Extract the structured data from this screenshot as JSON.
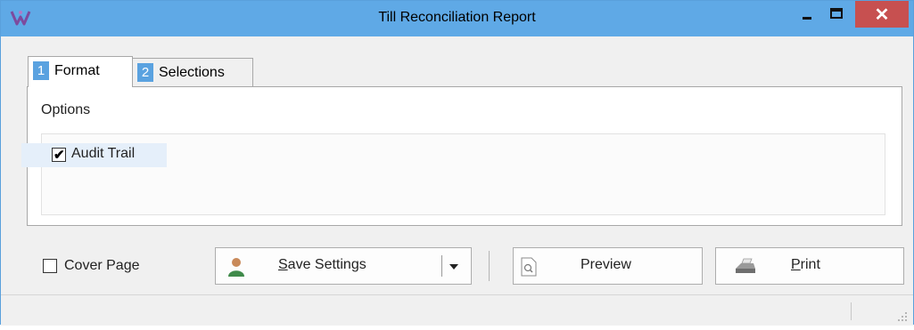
{
  "window": {
    "title": "Till Reconciliation Report",
    "close_glyph": "✕",
    "app_icon": "app-logo-icon"
  },
  "tabs": [
    {
      "number": "1",
      "label": "Format",
      "active": true
    },
    {
      "number": "2",
      "label": "Selections",
      "active": false
    }
  ],
  "options": {
    "group_label": "Options",
    "audit_trail": {
      "label": "Audit Trail",
      "checked": true
    }
  },
  "footer": {
    "cover_page": {
      "label": "Cover Page",
      "checked": false
    },
    "save_settings": {
      "label_key": "S",
      "label_rest": "ave Settings",
      "icon": "user-icon"
    },
    "preview": {
      "label": "Preview",
      "icon": "preview-document-icon"
    },
    "print": {
      "label_key": "P",
      "label_rest": "rint",
      "icon": "printer-icon"
    }
  },
  "colors": {
    "titlebar": "#5fa9e6",
    "close_button": "#c75050",
    "tab_number": "#5aa2e0",
    "selection_highlight": "#e5effa"
  }
}
